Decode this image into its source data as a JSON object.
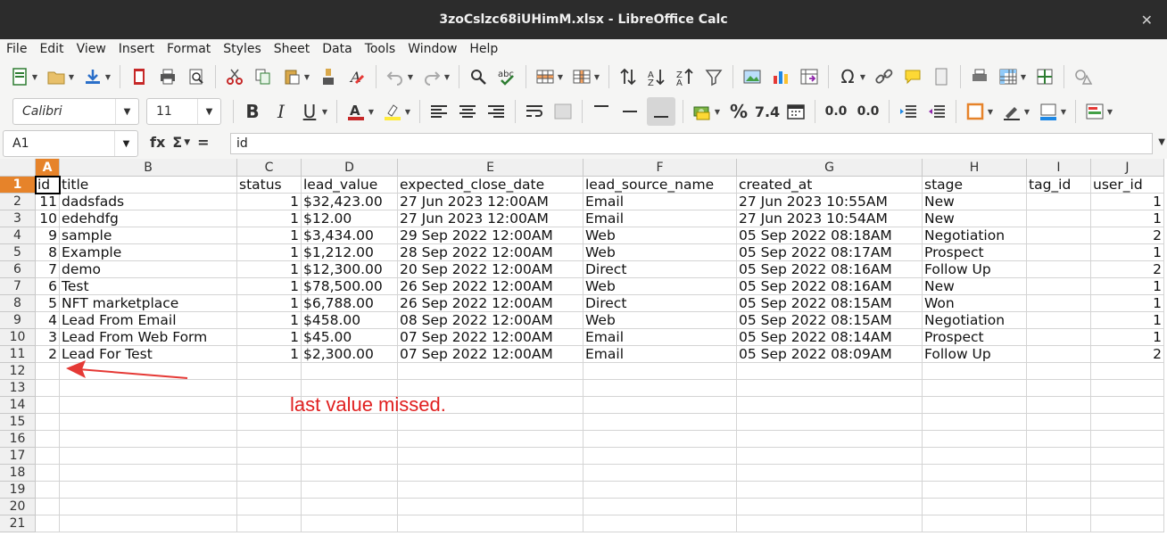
{
  "window": {
    "title": "3zoCslzc68iUHimM.xlsx - LibreOffice Calc",
    "close_glyph": "✕"
  },
  "menu": [
    "File",
    "Edit",
    "View",
    "Insert",
    "Format",
    "Styles",
    "Sheet",
    "Data",
    "Tools",
    "Window",
    "Help"
  ],
  "toolbar": {
    "font_name": "Calibri",
    "font_size": "11",
    "percent_label": "%",
    "number_label": "7.4",
    "decimal_add_label": "0.0",
    "decimal_remove_label": "0.0"
  },
  "formula_bar": {
    "name_box": "A1",
    "fx_label": "fx",
    "sigma_label": "Σ",
    "equals_label": "=",
    "content": "id"
  },
  "columns": [
    "A",
    "B",
    "C",
    "D",
    "E",
    "F",
    "G",
    "H",
    "I",
    "J"
  ],
  "selected_column": "A",
  "selected_row": 1,
  "rows_shown": [
    "1",
    "2",
    "3",
    "4",
    "5",
    "6",
    "7",
    "8",
    "9",
    "10",
    "11",
    "12",
    "13",
    "14",
    "15",
    "16",
    "17",
    "18",
    "19",
    "20",
    "21"
  ],
  "sheet": [
    [
      "id",
      "title",
      "status",
      "lead_value",
      "expected_close_date",
      "lead_source_name",
      "created_at",
      "stage",
      "tag_id",
      "user_id"
    ],
    [
      "11",
      "dadsfads",
      "1",
      "$32,423.00",
      "27 Jun 2023 12:00AM",
      "Email",
      "27 Jun 2023 10:55AM",
      "New",
      "",
      "1"
    ],
    [
      "10",
      "edehdfg",
      "1",
      "$12.00",
      "27 Jun 2023 12:00AM",
      "Email",
      "27 Jun 2023 10:54AM",
      "New",
      "",
      "1"
    ],
    [
      "9",
      "sample",
      "1",
      "$3,434.00",
      "29 Sep 2022 12:00AM",
      "Web",
      "05 Sep 2022 08:18AM",
      "Negotiation",
      "",
      "2"
    ],
    [
      "8",
      "Example",
      "1",
      "$1,212.00",
      "28 Sep 2022 12:00AM",
      "Web",
      "05 Sep 2022 08:17AM",
      "Prospect",
      "",
      "1"
    ],
    [
      "7",
      "demo",
      "1",
      "$12,300.00",
      "20 Sep 2022 12:00AM",
      "Direct",
      "05 Sep 2022 08:16AM",
      "Follow Up",
      "",
      "2"
    ],
    [
      "6",
      "Test",
      "1",
      "$78,500.00",
      "26 Sep 2022 12:00AM",
      "Web",
      "05 Sep 2022 08:16AM",
      "New",
      "",
      "1"
    ],
    [
      "5",
      "NFT marketplace",
      "1",
      "$6,788.00",
      "26 Sep 2022 12:00AM",
      "Direct",
      "05 Sep 2022 08:15AM",
      "Won",
      "",
      "1"
    ],
    [
      "4",
      "Lead From Email",
      "1",
      "$458.00",
      "08 Sep 2022 12:00AM",
      "Web",
      "05 Sep 2022 08:15AM",
      "Negotiation",
      "",
      "1"
    ],
    [
      "3",
      "Lead From Web Form",
      "1",
      "$45.00",
      "07 Sep 2022 12:00AM",
      "Email",
      "05 Sep 2022 08:14AM",
      "Prospect",
      "",
      "1"
    ],
    [
      "2",
      "Lead For Test",
      "1",
      "$2,300.00",
      "07 Sep 2022 12:00AM",
      "Email",
      "05 Sep 2022 08:09AM",
      "Follow Up",
      "",
      "2"
    ]
  ],
  "numeric_columns": [
    0,
    2,
    9
  ],
  "annotation": {
    "text": "last value missed.",
    "color": "#e02020"
  },
  "colors": {
    "selection_header": "#e6832a",
    "titlebar": "#2c2c2c"
  }
}
